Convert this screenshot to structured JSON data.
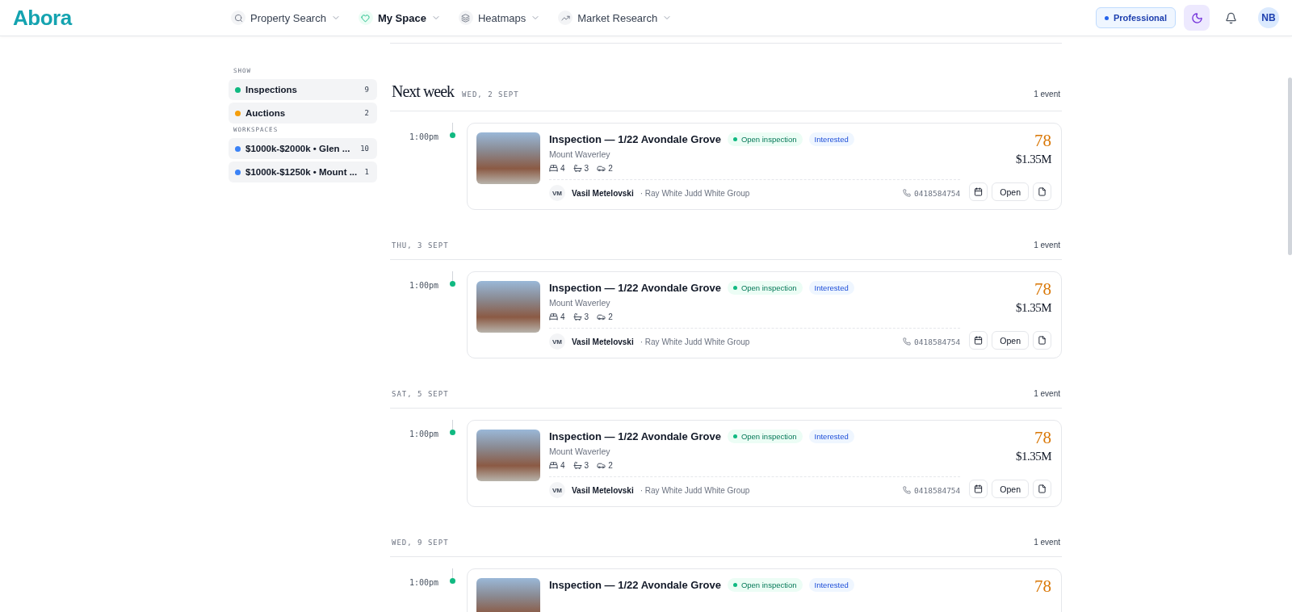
{
  "brand": "Abora",
  "nav": [
    {
      "label": "Property Search",
      "selected": false
    },
    {
      "label": "My Space",
      "selected": true
    },
    {
      "label": "Heatmaps",
      "selected": false
    },
    {
      "label": "Market Research",
      "selected": false
    }
  ],
  "plan": "Professional",
  "avatar": "NB",
  "sidebar": {
    "sections": [
      {
        "heading": "SHOW",
        "items": [
          {
            "label": "Inspections",
            "count": "9",
            "color": "#10b981"
          },
          {
            "label": "Auctions",
            "count": "2",
            "color": "#f59e0b"
          }
        ]
      },
      {
        "heading": "WORKSPACES",
        "items": [
          {
            "label": "$1000k-$2000k • Glen ...",
            "count": "10",
            "color": "#3b82f6"
          },
          {
            "label": "$1000k-$1250k • Mount ...",
            "count": "1",
            "color": "#3b82f6"
          }
        ]
      }
    ]
  },
  "days": [
    {
      "title": "Next week",
      "date": "WED, 2 SEPT",
      "count": "1 event",
      "events": [
        {
          "time": "1:00pm",
          "title": "Inspection — 1/22 Avondale Grove",
          "status": "Open inspection",
          "tag": "Interested",
          "suburb": "Mount Waverley",
          "beds": "4",
          "baths": "3",
          "cars": "2",
          "initials": "VM",
          "agent": "Vasil Metelovski",
          "agency": "· Ray White Judd White Group",
          "phone": "0418584754",
          "score": "78",
          "price": "$1.35M",
          "action": "Open"
        }
      ]
    },
    {
      "date": "THU, 3 SEPT",
      "count": "1 event",
      "events": [
        {
          "time": "1:00pm",
          "title": "Inspection — 1/22 Avondale Grove",
          "status": "Open inspection",
          "tag": "Interested",
          "suburb": "Mount Waverley",
          "beds": "4",
          "baths": "3",
          "cars": "2",
          "initials": "VM",
          "agent": "Vasil Metelovski",
          "agency": "· Ray White Judd White Group",
          "phone": "0418584754",
          "score": "78",
          "price": "$1.35M",
          "action": "Open"
        }
      ]
    },
    {
      "date": "SAT, 5 SEPT",
      "count": "1 event",
      "events": [
        {
          "time": "1:00pm",
          "title": "Inspection — 1/22 Avondale Grove",
          "status": "Open inspection",
          "tag": "Interested",
          "suburb": "Mount Waverley",
          "beds": "4",
          "baths": "3",
          "cars": "2",
          "initials": "VM",
          "agent": "Vasil Metelovski",
          "agency": "· Ray White Judd White Group",
          "phone": "0418584754",
          "score": "78",
          "price": "$1.35M",
          "action": "Open"
        }
      ]
    },
    {
      "date": "WED, 9 SEPT",
      "count": "1 event",
      "events": [
        {
          "time": "1:00pm",
          "title": "Inspection — 1/22 Avondale Grove",
          "status": "Open inspection",
          "tag": "Interested",
          "score": "78"
        }
      ]
    }
  ]
}
